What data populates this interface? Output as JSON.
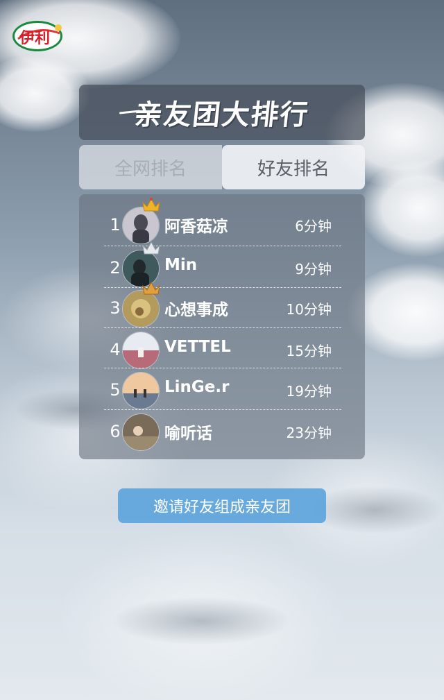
{
  "brand": {
    "logo_text": "伊利"
  },
  "title": "亲友团大排行",
  "tabs": [
    {
      "label": "全网排名",
      "active": false
    },
    {
      "label": "好友排名",
      "active": true
    }
  ],
  "ranking": [
    {
      "rank": "1",
      "name": "阿香菇凉",
      "time": "6分钟",
      "crown": "gold-crown-icon"
    },
    {
      "rank": "2",
      "name": "Min",
      "time": "9分钟",
      "crown": "silver-crown-icon"
    },
    {
      "rank": "3",
      "name": "心想事成",
      "time": "10分钟",
      "crown": "bronze-crown-icon"
    },
    {
      "rank": "4",
      "name": "VETTEL",
      "time": "15分钟"
    },
    {
      "rank": "5",
      "name": "LinGe.r",
      "time": "19分钟"
    },
    {
      "rank": "6",
      "name": "喻听话",
      "time": "23分钟"
    }
  ],
  "invite_button": "邀请好友组成亲友团",
  "colors": {
    "panel": "#5f6a78",
    "accent_button": "#55a0dc",
    "gold": "#f0b429"
  }
}
